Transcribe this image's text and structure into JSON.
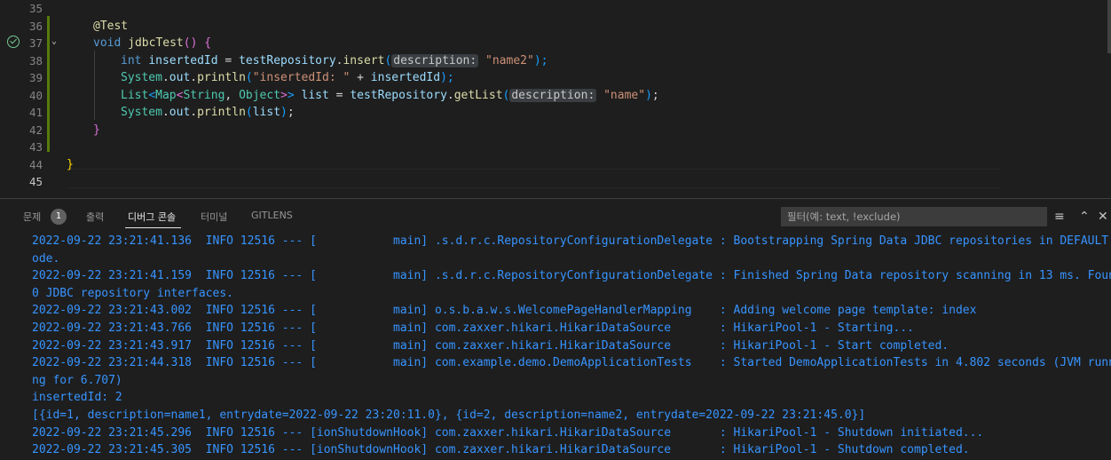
{
  "editor": {
    "line_numbers": [
      "35",
      "36",
      "37",
      "38",
      "39",
      "40",
      "41",
      "42",
      "43",
      "44",
      "45"
    ],
    "code": {
      "l36_ann": "@Test",
      "l37_void": "void",
      "l37_fn": "jdbcTest",
      "l37_paren": "()",
      "l37_brace": "{",
      "l38_int": "int",
      "l38_var": "insertedId",
      "l38_eq": " = ",
      "l38_obj": "testRepository",
      "l38_dot": ".",
      "l38_fn": "insert",
      "l38_open": "(",
      "l38_hint": "description:",
      "l38_str": "\"name2\"",
      "l38_close": ");",
      "l39_sys": "System",
      "l39_out": "out",
      "l39_fn": "println",
      "l39_str": "\"insertedId: \"",
      "l39_plus": " + ",
      "l39_var": "insertedId",
      "l39_close": ");",
      "l40_list": "List",
      "l40_map": "Map",
      "l40_string": "String",
      "l40_object": "Object",
      "l40_var": "list",
      "l40_obj": "testRepository",
      "l40_fn": "getList",
      "l40_hint": "description:",
      "l40_str": "\"name\"",
      "l41_sys": "System",
      "l41_out": "out",
      "l41_fn": "println",
      "l41_var": "list",
      "l42_brace": "}",
      "l44_brace": "}"
    }
  },
  "panel": {
    "tabs": [
      "문제",
      "출력",
      "디버그 콘솔",
      "터미널",
      "GITLENS"
    ],
    "problems_count": "1",
    "filter_placeholder": "필터(예: text, !exclude)",
    "icons": [
      "filter-lines-icon",
      "chevron-up-icon",
      "close-icon"
    ]
  },
  "output": [
    "2022-09-22 23:21:41.136  INFO 12516 --- [           main] .s.d.r.c.RepositoryConfigurationDelegate : Bootstrapping Spring Data JDBC repositories in DEFAULT m",
    "ode.",
    "2022-09-22 23:21:41.159  INFO 12516 --- [           main] .s.d.r.c.RepositoryConfigurationDelegate : Finished Spring Data repository scanning in 13 ms. Found",
    "0 JDBC repository interfaces.",
    "2022-09-22 23:21:43.002  INFO 12516 --- [           main] o.s.b.a.w.s.WelcomePageHandlerMapping    : Adding welcome page template: index",
    "2022-09-22 23:21:43.766  INFO 12516 --- [           main] com.zaxxer.hikari.HikariDataSource       : HikariPool-1 - Starting...",
    "2022-09-22 23:21:43.917  INFO 12516 --- [           main] com.zaxxer.hikari.HikariDataSource       : HikariPool-1 - Start completed.",
    "2022-09-22 23:21:44.318  INFO 12516 --- [           main] com.example.demo.DemoApplicationTests    : Started DemoApplicationTests in 4.802 seconds (JVM runni",
    "ng for 6.707)",
    "insertedId: 2",
    "[{id=1, description=name1, entrydate=2022-09-22 23:20:11.0}, {id=2, description=name2, entrydate=2022-09-22 23:21:45.0}]",
    "2022-09-22 23:21:45.296  INFO 12516 --- [ionShutdownHook] com.zaxxer.hikari.HikariDataSource       : HikariPool-1 - Shutdown initiated...",
    "2022-09-22 23:21:45.305  INFO 12516 --- [ionShutdownHook] com.zaxxer.hikari.HikariDataSource       : HikariPool-1 - Shutdown completed."
  ],
  "colors": {
    "background": "#1e1e1e",
    "output_text": "#3794ff",
    "keyword": "#569cd6",
    "function": "#dcdcaa",
    "string": "#ce9178"
  }
}
